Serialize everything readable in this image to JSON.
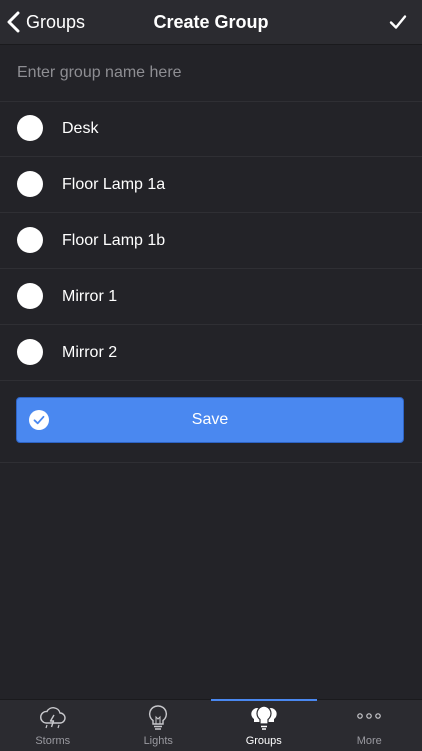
{
  "nav": {
    "back_label": "Groups",
    "title": "Create Group"
  },
  "name_field": {
    "value": "",
    "placeholder": "Enter group name here"
  },
  "lights": [
    {
      "label": "Desk",
      "selected": false
    },
    {
      "label": "Floor Lamp 1a",
      "selected": false
    },
    {
      "label": "Floor Lamp 1b",
      "selected": false
    },
    {
      "label": "Mirror 1",
      "selected": false
    },
    {
      "label": "Mirror 2",
      "selected": false
    }
  ],
  "save": {
    "label": "Save",
    "icon": "check-circle-icon"
  },
  "tabs": [
    {
      "label": "Storms",
      "icon": "storm-cloud-icon",
      "active": false
    },
    {
      "label": "Lights",
      "icon": "light-bulb-icon",
      "active": false
    },
    {
      "label": "Groups",
      "icon": "bulb-group-icon",
      "active": true
    },
    {
      "label": "More",
      "icon": "more-dots-icon",
      "active": false
    }
  ],
  "colors": {
    "background": "#232328",
    "bar": "#2b2b30",
    "accent": "#4a88f0"
  }
}
